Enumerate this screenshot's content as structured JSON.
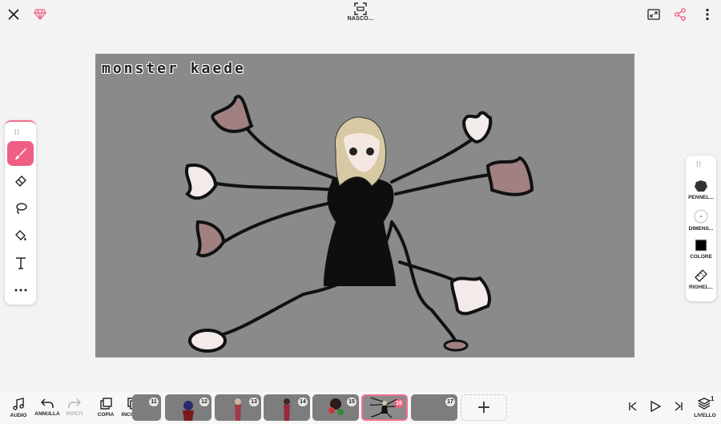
{
  "topbar": {
    "close_icon": "close-icon",
    "premium_icon": "diamond-icon",
    "hide_label": "NASCO...",
    "fullscreen_icon": "fullscreen-icon",
    "share_icon": "share-icon",
    "more_icon": "more-vertical-icon"
  },
  "canvas": {
    "title_text": "monster kaede",
    "background": "#8a8a8a"
  },
  "tools": [
    {
      "name": "brush",
      "icon": "brush-icon",
      "active": true
    },
    {
      "name": "eraser",
      "icon": "eraser-icon",
      "active": false
    },
    {
      "name": "lasso",
      "icon": "lasso-icon",
      "active": false
    },
    {
      "name": "fill",
      "icon": "bucket-icon",
      "active": false
    },
    {
      "name": "text",
      "icon": "text-icon",
      "active": false
    },
    {
      "name": "more",
      "icon": "more-horizontal-icon",
      "active": false
    }
  ],
  "right_panel": {
    "brush_label": "PENNEL...",
    "size_label": "DIMENS...",
    "color_label": "COLORE",
    "ruler_label": "RIGHEL...",
    "current_color": "#000000"
  },
  "bottombar": {
    "audio_label": "AUDIO",
    "undo_label": "ANNULLA",
    "redo_label": "RIPETI",
    "copy_label": "COPIA",
    "paste_label": "INCOLLA",
    "layer_label": "LIVELLO",
    "layer_count": "1"
  },
  "frames": [
    {
      "num": "11"
    },
    {
      "num": "12"
    },
    {
      "num": "13"
    },
    {
      "num": "14"
    },
    {
      "num": "15"
    },
    {
      "num": "16",
      "active": true
    },
    {
      "num": "17"
    }
  ],
  "accent_color": "#f05f83"
}
